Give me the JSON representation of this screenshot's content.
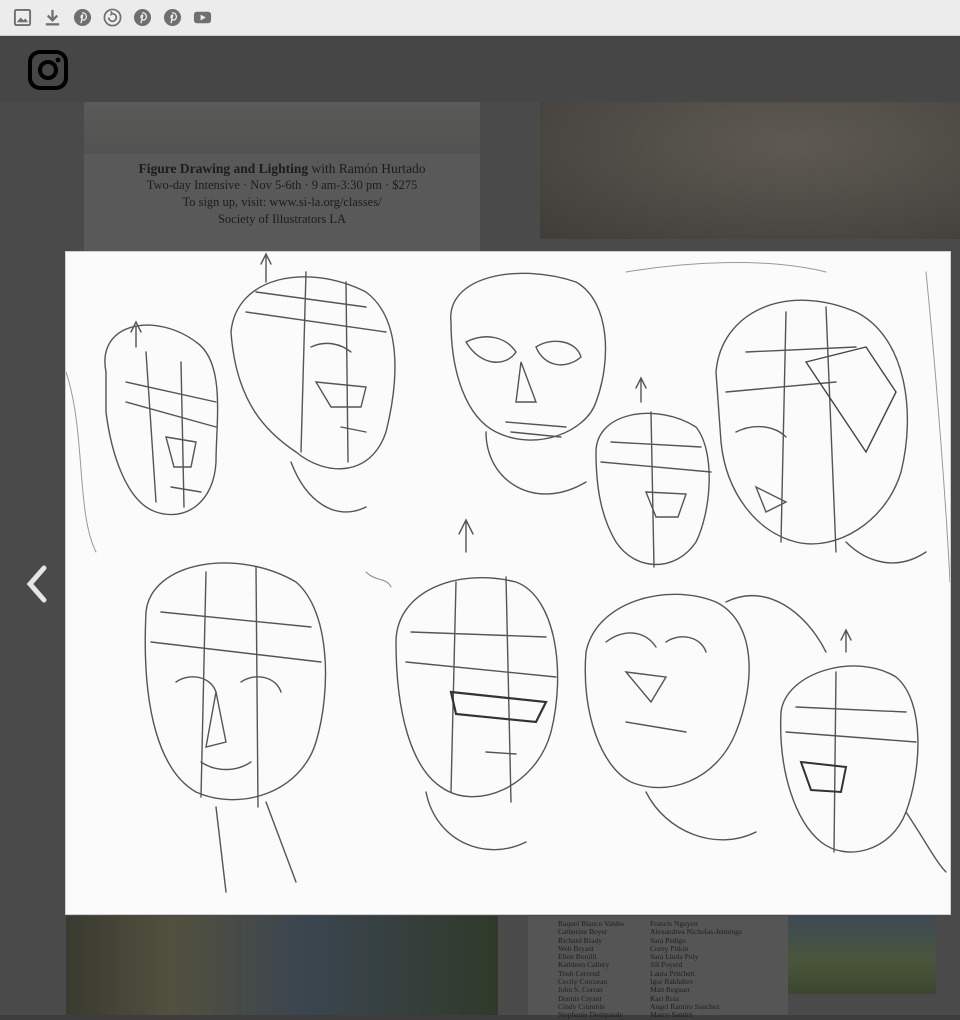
{
  "toolbar": {
    "buttons": [
      {
        "name": "image-icon"
      },
      {
        "name": "download-icon"
      },
      {
        "name": "pinterest-icon"
      },
      {
        "name": "refresh-circle-icon"
      },
      {
        "name": "pinterest-icon"
      },
      {
        "name": "pinterest-icon"
      },
      {
        "name": "youtube-icon"
      }
    ]
  },
  "header": {
    "icon": "instagram-icon"
  },
  "background_post": {
    "title_bold": "Figure Drawing and Lighting",
    "title_rest": " with Ramón Hurtado",
    "line2": "Two-day Intensive · Nov 5-6th · 9 am-3:30 pm · $275",
    "line3": "To sign up, visit: www.si-la.org/classes/",
    "line4": "Society of Illustrators LA",
    "names_col1": [
      "Raquel Blanco Valdes",
      "Catherine Boyer",
      "Richard Brady",
      "Web Bryant",
      "Ellen Bonilli",
      "Kathleen Callery",
      "Trish Cerrend",
      "Cecily Corcoran",
      "John S. Corran",
      "Dennis Cryant",
      "Cindy Crimmie",
      "Stephanie Deshpande"
    ],
    "names_col2": [
      "Francis Nguyen",
      "Alexandrea Nicholas-Jennings",
      "Sara Pedigo",
      "Corey Pitkin",
      "Sara Linda Poly",
      "Jill Poyerd",
      "Laura Pritchett",
      "Igor Rakhdiev",
      "Matt Reguart",
      "Kari Ruiz",
      "Angel Ramiro Sanchez",
      "Marco Santini"
    ]
  },
  "navigation": {
    "prev": "chevron-left-icon"
  },
  "colors": {
    "toolbar_bg": "#ececec",
    "overlay_bg": "#3d3d3d",
    "icon_gray": "#6f6f6f"
  }
}
